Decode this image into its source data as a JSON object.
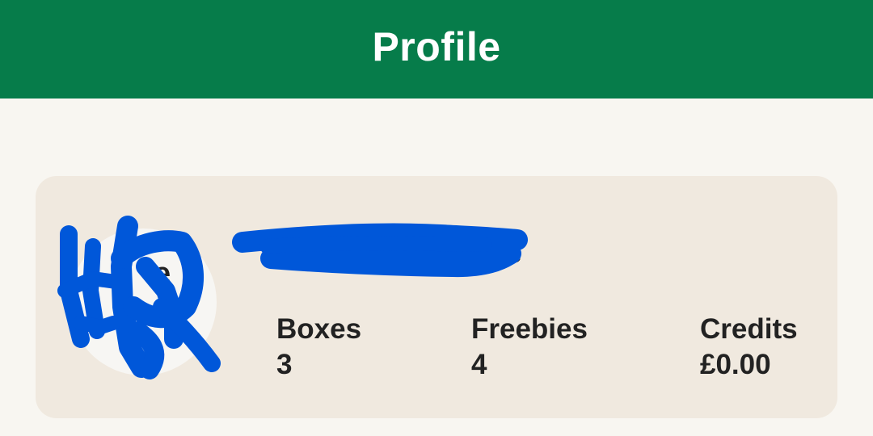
{
  "header": {
    "title": "Profile"
  },
  "colors": {
    "header_bg": "#067c4a",
    "page_bg": "#f8f6f1",
    "card_bg": "#f0e9df",
    "scribble": "#0057d9"
  },
  "profile": {
    "avatar_initial": "e",
    "username_visible_fragment": "ane",
    "redaction": "blue-scribble",
    "stats": [
      {
        "label": "Boxes",
        "value": "3"
      },
      {
        "label": "Freebies",
        "value": "4"
      },
      {
        "label": "Credits",
        "value": "£0.00"
      }
    ]
  },
  "icons": {
    "avatar": "user-avatar-icon"
  }
}
